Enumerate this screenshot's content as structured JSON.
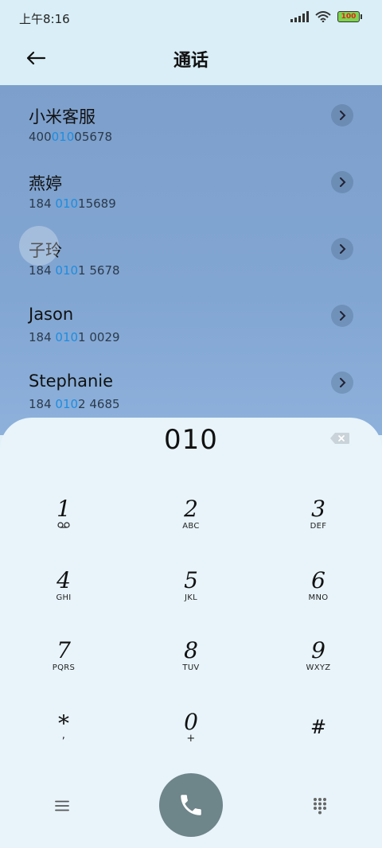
{
  "status": {
    "time": "上午8:16",
    "battery": "100"
  },
  "header": {
    "title": "通话"
  },
  "contacts": [
    {
      "name": "小米客服",
      "pre": "400",
      "match": "010",
      "post": "05678"
    },
    {
      "name": "燕婷",
      "pre": "184 ",
      "match": "010",
      "post": "15689"
    },
    {
      "name": "子玲",
      "pre": "184 ",
      "match": "010",
      "post": "1 5678"
    },
    {
      "name": "Jason",
      "pre": "184 ",
      "match": "010",
      "post": "1 0029"
    },
    {
      "name": "Stephanie",
      "pre": "184 ",
      "match": "010",
      "post": "2 4685"
    }
  ],
  "dialpad": {
    "input": "010",
    "keys": [
      {
        "digit": "1",
        "letters": ""
      },
      {
        "digit": "2",
        "letters": "ABC"
      },
      {
        "digit": "3",
        "letters": "DEF"
      },
      {
        "digit": "4",
        "letters": "GHI"
      },
      {
        "digit": "5",
        "letters": "JKL"
      },
      {
        "digit": "6",
        "letters": "MNO"
      },
      {
        "digit": "7",
        "letters": "PQRS"
      },
      {
        "digit": "8",
        "letters": "TUV"
      },
      {
        "digit": "9",
        "letters": "WXYZ"
      },
      {
        "digit": "*",
        "letters": ","
      },
      {
        "digit": "0",
        "letters": "+"
      },
      {
        "digit": "#",
        "letters": ""
      }
    ]
  },
  "icons": {
    "back": "arrow-left-icon",
    "arrow": "chevron-right-icon",
    "backspace": "backspace-icon",
    "voicemail": "voicemail-icon",
    "menu": "menu-icon",
    "call": "phone-icon",
    "dialpad": "dialpad-icon"
  },
  "colors": {
    "highlight": "#1e8de0",
    "call_button": "#6e858a"
  }
}
